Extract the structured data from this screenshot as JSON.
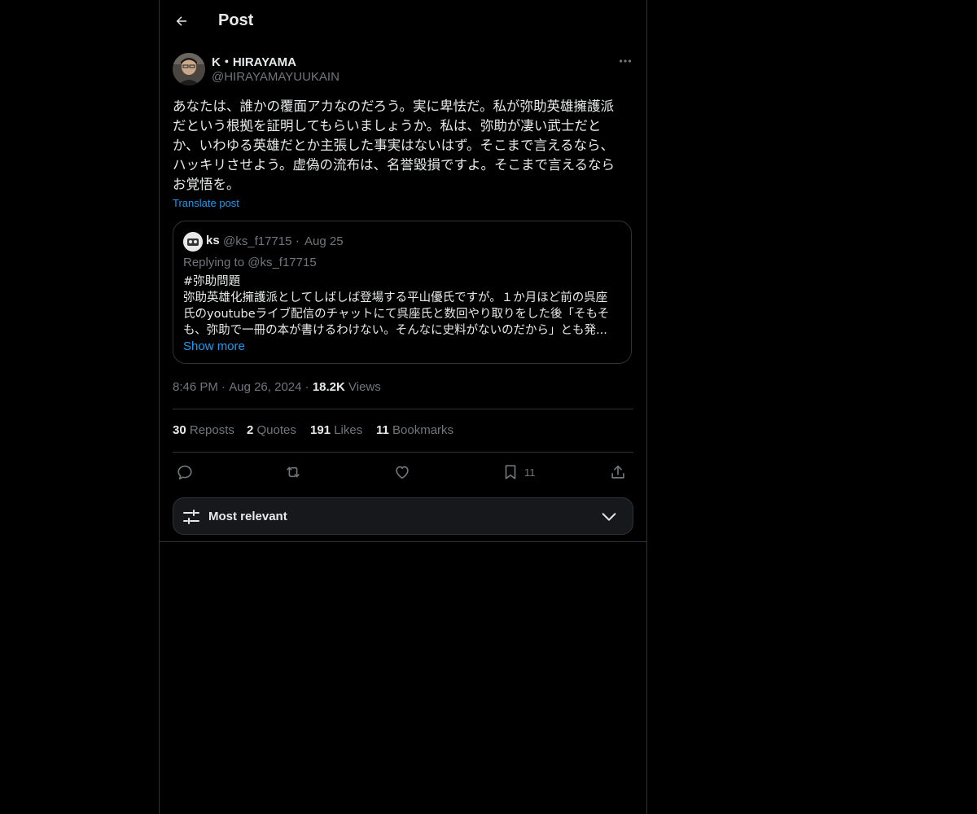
{
  "header": {
    "title": "Post",
    "back_icon": "back-arrow-icon"
  },
  "post": {
    "author_name": "K・HIRAYAMA",
    "author_handle": "@HIRAYAMAYUUKAIN",
    "text": "あなたは、誰かの覆面アカなのだろう。実に卑怯だ。私が弥助英雄擁護派\nだという根拠を証明してもらいましょうか。私は、弥助が凄い武士だと\nか、いわゆる英雄だとか主張した事実はないはず。そこまで言えるなら、\nハッキリさせよう。虚偽の流布は、名誉毀損ですよ。そこまで言えるなら\nお覚悟を。",
    "translate_label": "Translate post",
    "time": "8:46 PM",
    "date": "Aug 26, 2024",
    "views_count": "18.2K",
    "views_label": "Views"
  },
  "quote": {
    "name": "ks",
    "handle": "@ks_f17715",
    "date": "Aug 25",
    "replying": "Replying to @ks_f17715",
    "text": "#弥助問題\n弥助英雄化擁護派としてしばしば登場する平山優氏ですが。１か月ほど前の呉座\n氏のyoutubeライブ配信のチャットにて呉座氏と数回やり取りをした後「そもそ\nも、弥助で一冊の本が書けるわけない。そんなに史料がないのだから」とも発...",
    "show_more": "Show more"
  },
  "stats": {
    "reposts_count": "30",
    "reposts_label": "Reposts",
    "quotes_count": "2",
    "quotes_label": "Quotes",
    "likes_count": "191",
    "likes_label": "Likes",
    "bookmarks_count": "11",
    "bookmarks_label": "Bookmarks"
  },
  "actions": {
    "bookmark_count": "11"
  },
  "sort": {
    "label": "Most relevant"
  },
  "colors": {
    "background": "#000000",
    "text": "#e7e9ea",
    "muted": "#71767b",
    "accent": "#1d9bf0",
    "border": "#2f3336"
  }
}
